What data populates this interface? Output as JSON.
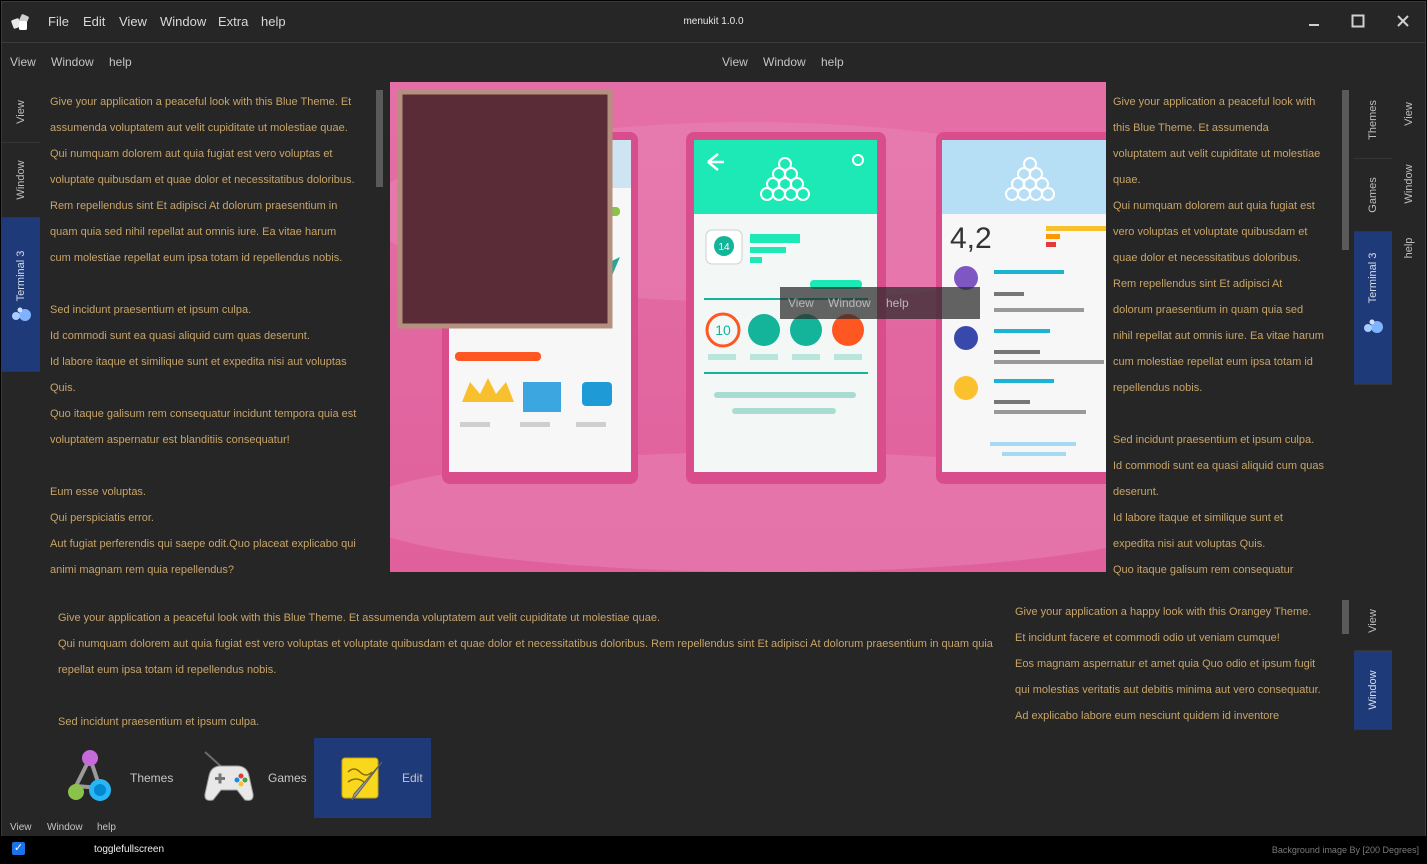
{
  "app": {
    "title": "menukit 1.0.0"
  },
  "menubar": [
    "File",
    "Edit",
    "View",
    "Window",
    "Extra",
    "help"
  ],
  "subbar_left": [
    "View",
    "Window",
    "help"
  ],
  "subbar_center": [
    "View",
    "Window",
    "help"
  ],
  "overlay_menu": [
    "View",
    "Window",
    "help"
  ],
  "left_tabs": [
    "View",
    "Window",
    "Terminal 3"
  ],
  "right_tabs": [
    "Themes",
    "Games",
    "Terminal 3"
  ],
  "right_outer_tabs": [
    "View",
    "Window",
    "help"
  ],
  "bottom_right_tabs": [
    "View",
    "Window"
  ],
  "text_left": [
    "Give your application a peaceful look with this Blue Theme. Et",
    "assumenda voluptatem aut velit cupiditate ut molestiae quae.",
    "Qui numquam dolorem aut quia fugiat est vero voluptas et",
    "voluptate quibusdam et quae dolor et necessitatibus doloribus.",
    "Rem repellendus sint Et adipisci At dolorum praesentium in",
    "quam quia sed nihil repellat aut omnis iure. Ea vitae harum",
    "cum molestiae repellat eum ipsa totam id repellendus nobis.",
    "",
    "Sed incidunt praesentium et ipsum culpa.",
    "Id commodi sunt ea quasi aliquid cum quas deserunt.",
    "Id labore itaque et similique sunt et expedita nisi aut voluptas",
    "Quis.",
    "Quo itaque galisum rem consequatur incidunt tempora quia est",
    "voluptatem aspernatur est blanditiis consequatur!",
    "",
    "Eum esse voluptas.",
    "Qui perspiciatis error.",
    "Aut fugiat perferendis qui saepe odit.Quo placeat explicabo qui",
    "animi magnam rem quia repellendus?"
  ],
  "text_right": [
    "Give your application a peaceful look with",
    "this Blue Theme. Et assumenda",
    "voluptatem aut velit cupiditate ut molestiae",
    "quae.",
    "Qui numquam dolorem aut quia fugiat est",
    "vero voluptas et voluptate quibusdam et",
    "quae dolor et necessitatibus doloribus.",
    "Rem repellendus sint Et adipisci At",
    "dolorum praesentium in quam quia sed",
    "nihil repellat aut omnis iure. Ea vitae harum",
    "cum molestiae repellat eum ipsa totam id",
    "repellendus nobis.",
    "",
    "Sed incidunt praesentium et ipsum culpa.",
    "Id commodi sunt ea quasi aliquid cum quas",
    "deserunt.",
    "Id labore itaque et similique sunt et",
    "expedita nisi aut voluptas Quis.",
    "Quo itaque galisum rem consequatur"
  ],
  "text_bottom_left": [
    "Give your application a peaceful look with this Blue Theme. Et assumenda voluptatem aut velit cupiditate ut molestiae quae.",
    "Qui numquam dolorem aut quia fugiat est vero voluptas et voluptate quibusdam et quae dolor et necessitatibus doloribus. Rem repellendus sint Et adipisci At dolorum praesentium in quam quia",
    "repellat eum ipsa totam id repellendus nobis.",
    "",
    "Sed incidunt praesentium et ipsum culpa."
  ],
  "text_bottom_right": [
    "Give your application a happy look with this Orangey Theme.",
    "Et incidunt facere et commodi odio ut veniam cumque!",
    "Eos magnam aspernatur et amet quia Quo odio et ipsum fugit",
    "qui molestias veritatis aut debitis minima aut vero consequatur.",
    "Ad explicabo labore eum nesciunt quidem id inventore"
  ],
  "dock": [
    {
      "label": "Themes",
      "icon": "themes-icon"
    },
    {
      "label": "Games",
      "icon": "gamepad-icon"
    },
    {
      "label": "Edit",
      "icon": "notepad-icon",
      "active": true
    }
  ],
  "statusbar_menu": [
    "View",
    "Window",
    "help"
  ],
  "footer": {
    "checkbox_label": "togglefullscreen",
    "credit": "Background image By [200 Degrees]"
  },
  "mockup": {
    "rating": "4,2",
    "badge_number": "10",
    "circle_number": "14"
  },
  "colors": {
    "accent": "#1f3a78",
    "text": "#c8a468",
    "bg": "#262626",
    "image_pink": "#e772a7",
    "teal": "#1de9b6"
  }
}
